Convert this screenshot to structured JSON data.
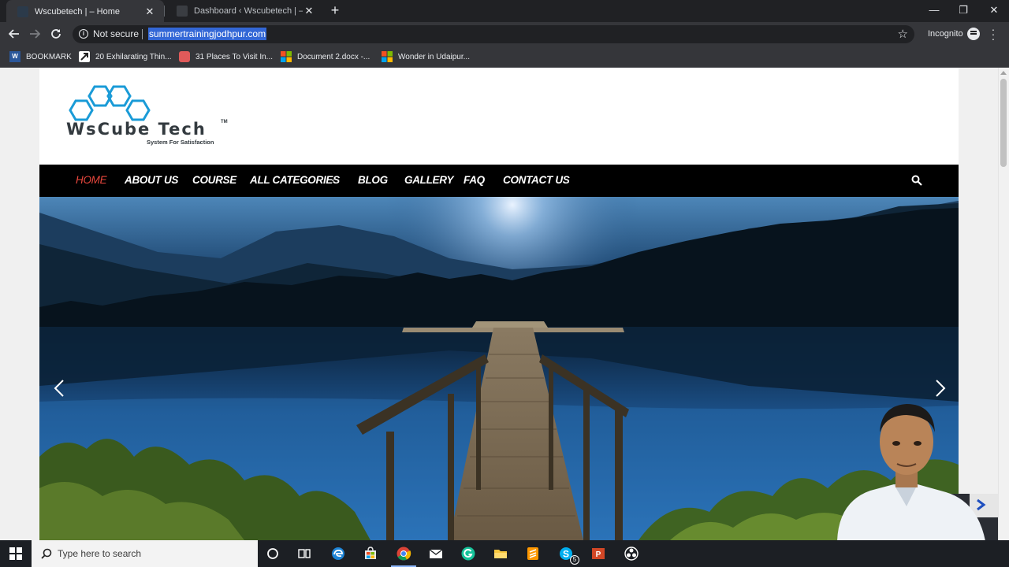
{
  "browser": {
    "tabs": [
      {
        "title": "Wscubetech | – Home",
        "active": true
      },
      {
        "title": "Dashboard ‹ Wscubetech | — W",
        "active": false
      }
    ],
    "address_bar": {
      "security_label": "Not secure",
      "url": "summertrainingjodhpur.com"
    },
    "profile_label": "Incognito",
    "bookmarks": [
      {
        "label": "BOOKMARK",
        "icon": "word-icon"
      },
      {
        "label": "20 Exhilarating Thin...",
        "icon": "arrow-favicon"
      },
      {
        "label": "31 Places To Visit In...",
        "icon": "red-favicon"
      },
      {
        "label": "Document 2.docx -...",
        "icon": "ms-office-favicon"
      },
      {
        "label": "Wonder in Udaipur...",
        "icon": "ms-office-favicon"
      }
    ]
  },
  "site": {
    "logo": {
      "name": "WsCube Tech",
      "tm": "TM",
      "tagline": "System For Satisfaction"
    },
    "nav": [
      {
        "label": "HOME",
        "current": true
      },
      {
        "label": "ABOUT US"
      },
      {
        "label": "COURSE"
      },
      {
        "label": "ALL CATEGORIES",
        "has_dropdown": true
      },
      {
        "label": "BLOG"
      },
      {
        "label": "GALLERY"
      },
      {
        "label": "FAQ"
      },
      {
        "label": "CONTACT US"
      }
    ],
    "accent_color": "#e8473d",
    "nav_background": "#000000"
  },
  "taskbar": {
    "search_placeholder": "Type here to search",
    "skype_badge": "5",
    "apps": [
      "cortana",
      "task-view",
      "edge",
      "store",
      "chrome",
      "mail",
      "grammarly",
      "file-explorer",
      "sublime-text",
      "skype",
      "powerpoint",
      "obs"
    ]
  }
}
